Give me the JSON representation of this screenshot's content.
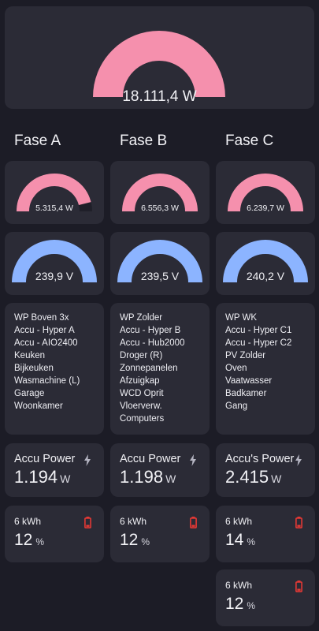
{
  "colors": {
    "background": "#1c1c26",
    "card": "#2b2b36",
    "power_arc": "#f590ad",
    "voltage_arc": "#8cb4ff",
    "gauge_track": "#1f1f29",
    "battery_icon": "#e53935",
    "bolt_icon": "#b5b5c2"
  },
  "total": {
    "value": "18.111,4 W",
    "fraction": 1.0
  },
  "phases": [
    {
      "title": "Fase A",
      "power": {
        "value": "5.315,4 W",
        "fraction": 0.92
      },
      "voltage": {
        "value": "239,9 V",
        "fraction": 1.0
      },
      "circuits": [
        "WP Boven 3x",
        "Accu - Hyper A",
        "Accu - AIO2400",
        "Keuken",
        "Bijkeuken",
        "Wasmachine (L)",
        "Garage",
        "Woonkamer"
      ],
      "accu": {
        "label": "Accu Power",
        "value": "1.194",
        "unit": "W",
        "icon": "bolt-icon"
      },
      "batteries": [
        {
          "label": "6 kWh",
          "value": "12",
          "unit": "%",
          "icon": "battery-low-icon"
        }
      ]
    },
    {
      "title": "Fase B",
      "power": {
        "value": "6.556,3 W",
        "fraction": 1.0
      },
      "voltage": {
        "value": "239,5 V",
        "fraction": 1.0
      },
      "circuits": [
        "WP Zolder",
        "Accu - Hyper B",
        "Accu - Hub2000",
        "Droger (R)",
        "Zonnepanelen",
        "Afzuigkap",
        "WCD Oprit",
        "Vloerverw.",
        "Computers"
      ],
      "accu": {
        "label": "Accu Power",
        "value": "1.198",
        "unit": "W",
        "icon": "bolt-icon"
      },
      "batteries": [
        {
          "label": "6 kWh",
          "value": "12",
          "unit": "%",
          "icon": "battery-low-icon"
        }
      ]
    },
    {
      "title": "Fase C",
      "power": {
        "value": "6.239,7 W",
        "fraction": 1.0
      },
      "voltage": {
        "value": "240,2 V",
        "fraction": 1.0
      },
      "circuits": [
        "WP WK",
        "Accu - Hyper C1",
        "Accu - Hyper C2",
        "PV Zolder",
        "Oven",
        "Vaatwasser",
        "Badkamer",
        "Gang"
      ],
      "accu": {
        "label": "Accu's Power",
        "value": "2.415",
        "unit": "W",
        "icon": "bolt-icon"
      },
      "batteries": [
        {
          "label": "6 kWh",
          "value": "14",
          "unit": "%",
          "icon": "battery-low-icon"
        },
        {
          "label": "6 kWh",
          "value": "12",
          "unit": "%",
          "icon": "battery-low-icon"
        }
      ]
    }
  ]
}
